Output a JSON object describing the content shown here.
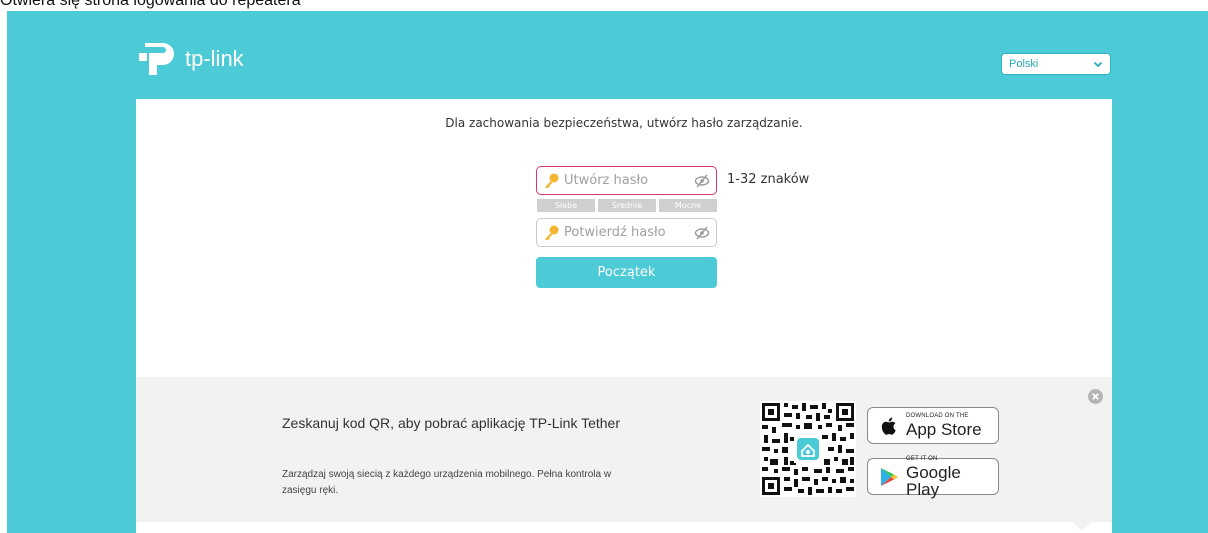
{
  "caption": "Otwiera się strona logowania do repeatera",
  "brand": {
    "logo_text": "tp-link"
  },
  "language": {
    "selected": "Polski"
  },
  "setup": {
    "message": "Dla zachowania bezpieczeństwa, utwórz hasło zarządzanie.",
    "password_placeholder": "Utwórz hasło",
    "confirm_placeholder": "Potwierdź hasło",
    "password_hint": "1-32 znaków",
    "strength_labels": [
      "Słabe",
      "Średnie",
      "Mocne"
    ],
    "start_button": "Początek"
  },
  "banner": {
    "title": "Zeskanuj kod QR, aby pobrać aplikację TP-Link Tether",
    "description": "Zarządzaj swoją siecią z każdego urządzenia mobilnego. Pełna kontrola w zasięgu ręki.",
    "app_store_small": "DOWNLOAD ON THE",
    "app_store_big": "App Store",
    "google_small": "GET IT ON",
    "google_big": "Google Play"
  },
  "colors": {
    "accent": "#4ccad6",
    "focus_border": "#d6357a",
    "banner_bg": "#f2f2f2"
  }
}
